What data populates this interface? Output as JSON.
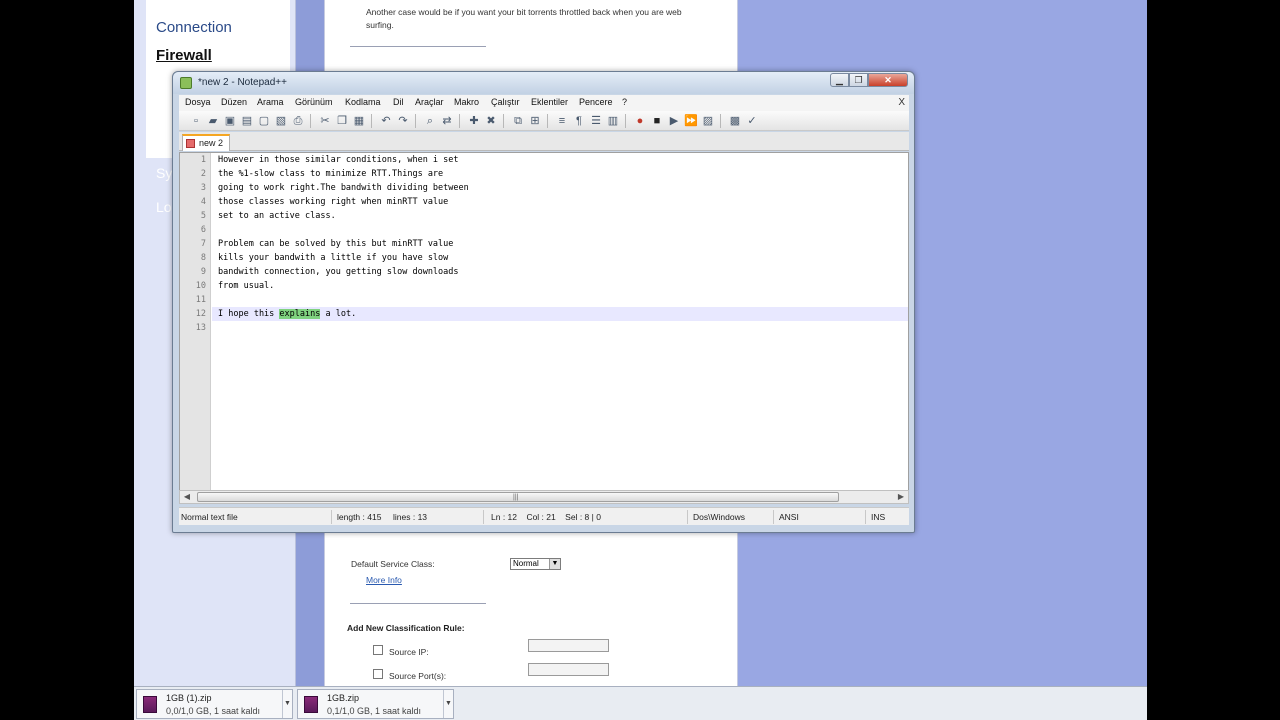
{
  "browser": {
    "nav": {
      "connection": "Connection",
      "firewall": "Firewall",
      "sy": "Sy",
      "lo": "Lo"
    },
    "content": {
      "intro_line1": "Another case would be if you want your bit torrents throttled back when you are web",
      "intro_line2": "surfing.",
      "default_service_label": "Default Service Class:",
      "default_service_value": "Normal",
      "more_info": "More Info",
      "add_rule_heading": "Add New Classification Rule:",
      "source_ip_label": "Source IP:",
      "source_port_label": "Source Port(s):"
    }
  },
  "notepad": {
    "title": "*new 2 - Notepad++",
    "menu": [
      "Dosya",
      "Düzen",
      "Arama",
      "Görünüm",
      "Kodlama",
      "Dil",
      "Araçlar",
      "Makro",
      "Çalıştır",
      "Eklentiler",
      "Pencere",
      "?"
    ],
    "doc_close": "X",
    "tab_label": "new 2",
    "lines": [
      "However in those similar conditions, when i set",
      "the %1-slow class to minimize RTT.Things are",
      "going to work right.The bandwith dividing between",
      "those classes working right when minRTT value",
      "set to an active class.",
      "",
      "Problem can be solved by this but minRTT value",
      "kills your bandwith a little if you have slow",
      "bandwith connection, you getting slow downloads",
      "from usual.",
      "",
      "I hope this explains a lot.",
      ""
    ],
    "line12_parts": {
      "before": "I hope this ",
      "highlight": "explains",
      "after": " a lot."
    },
    "line_numbers": [
      "1",
      "2",
      "3",
      "4",
      "5",
      "6",
      "7",
      "8",
      "9",
      "10",
      "11",
      "12",
      "13"
    ],
    "status": {
      "file_type": "Normal text file",
      "length": "length : 415",
      "lines": "lines : 13",
      "position": "Ln : 12    Col : 21    Sel : 8 | 0",
      "eol": "Dos\\Windows",
      "encoding": "ANSI",
      "mode": "INS"
    },
    "colors": {
      "highlight": "#7fd27f",
      "caret_line": "#e8e8ff",
      "tab_accent": "#f5a623"
    }
  },
  "downloads": [
    {
      "name": "1GB (1).zip",
      "info": "0,0/1,0 GB, 1 saat kaldı"
    },
    {
      "name": "1GB.zip",
      "info": "0,1/1,0 GB, 1 saat kaldı"
    }
  ]
}
